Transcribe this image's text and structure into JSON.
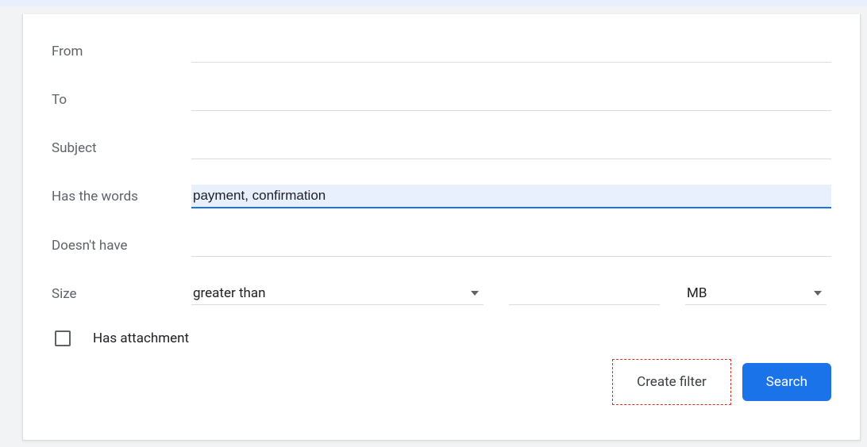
{
  "filter": {
    "fields": {
      "from": {
        "label": "From",
        "value": ""
      },
      "to": {
        "label": "To",
        "value": ""
      },
      "subject": {
        "label": "Subject",
        "value": ""
      },
      "has_words": {
        "label": "Has the words",
        "value": "payment, confirmation"
      },
      "doesnt_have": {
        "label": "Doesn't have",
        "value": ""
      }
    },
    "size": {
      "label": "Size",
      "comparator": "greater than",
      "value": "",
      "unit": "MB"
    },
    "attachment": {
      "label": "Has attachment",
      "checked": false
    },
    "actions": {
      "create_filter": "Create filter",
      "search": "Search"
    }
  }
}
